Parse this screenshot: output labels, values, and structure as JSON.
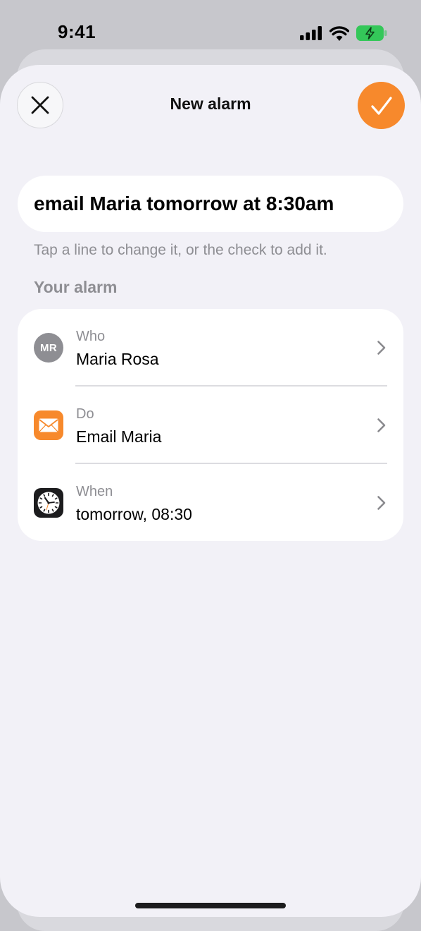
{
  "status_bar": {
    "time": "9:41",
    "icons": [
      "cellular-signal-icon",
      "wifi-icon",
      "battery-charging-icon"
    ]
  },
  "header": {
    "title": "New alarm",
    "close_icon": "close-icon",
    "confirm_icon": "checkmark-icon"
  },
  "query": {
    "value": "email Maria tomorrow at 8:30am"
  },
  "hint": "Tap a line to change it, or the check to add it.",
  "section_title": "Your alarm",
  "rows": [
    {
      "label": "Who",
      "value": "Maria Rosa",
      "icon": "avatar",
      "avatar_initials": "MR"
    },
    {
      "label": "Do",
      "value": "Email Maria",
      "icon": "mail-icon"
    },
    {
      "label": "When",
      "value": "tomorrow, 08:30",
      "icon": "clock-icon"
    }
  ],
  "colors": {
    "accent": "#f7892c",
    "sheet_background": "#f2f1f7",
    "secondary_text": "#8e8e93",
    "battery_fill": "#34c759"
  }
}
